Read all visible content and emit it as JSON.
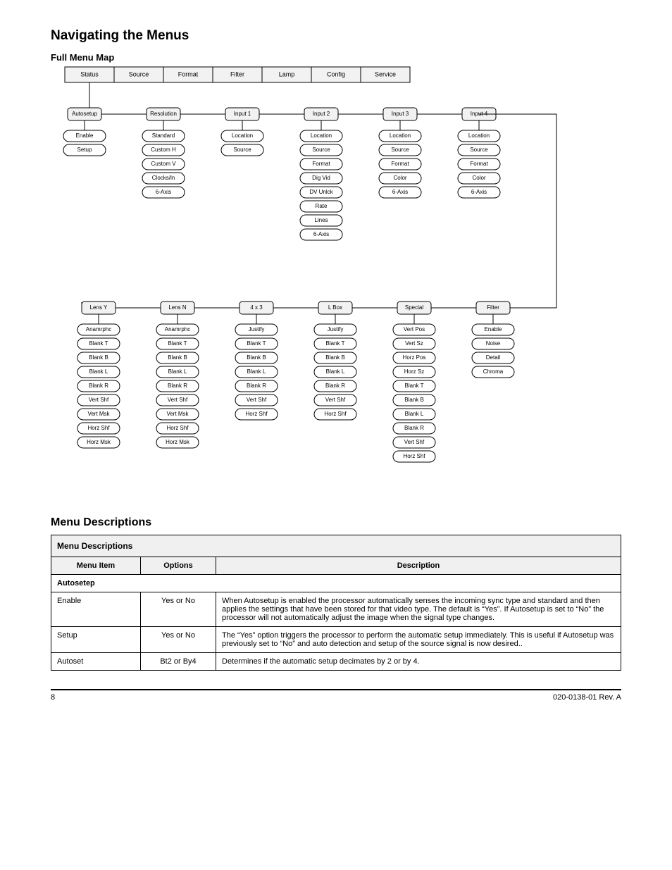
{
  "page": {
    "title": "Navigating the Menus",
    "diagram_label": "Full Menu Map",
    "menubar": [
      "Status",
      "Source",
      "Format",
      "Filter",
      "Lamp",
      "Config",
      "Service"
    ],
    "tree": {
      "row1": [
        {
          "head": "Autosetup",
          "items": [
            "Enable",
            "Setup"
          ]
        },
        {
          "head": "Resolution",
          "items": [
            "Standard",
            "Custom H",
            "Custom V",
            "Clocks/ln",
            "6-Axis"
          ]
        },
        {
          "head": "Input 1",
          "items": [
            "Location",
            "Source"
          ]
        },
        {
          "head": "Input 2",
          "items": [
            "Location",
            "Source",
            "Format",
            "Dig Vid",
            "DV Unlck",
            "Rate",
            "Lines",
            "6-Axis"
          ]
        },
        {
          "head": "Input 3",
          "items": [
            "Location",
            "Source",
            "Format",
            "Color",
            "6-Axis"
          ]
        },
        {
          "head": "Input 4",
          "items": [
            "Location",
            "Source",
            "Format",
            "Color",
            "6-Axis"
          ]
        }
      ],
      "row2": [
        {
          "head": "Lens Y",
          "items": [
            "Anamrphc",
            "Blank T",
            "Blank B",
            "Blank L",
            "Blank R",
            "Vert Shf",
            "Vert Msk",
            "Horz Shf",
            "Horz Msk"
          ]
        },
        {
          "head": "Lens N",
          "items": [
            "Anamrphc",
            "Blank T",
            "Blank B",
            "Blank L",
            "Blank R",
            "Vert Shf",
            "Vert Msk",
            "Horz Shf",
            "Horz Msk"
          ]
        },
        {
          "head": "4 x 3",
          "items": [
            "Justify",
            "Blank T",
            "Blank B",
            "Blank L",
            "Blank R",
            "Vert Shf",
            "Horz Shf"
          ]
        },
        {
          "head": "L Box",
          "items": [
            "Justify",
            "Blank T",
            "Blank B",
            "Blank L",
            "Blank R",
            "Vert Shf",
            "Horz Shf"
          ]
        },
        {
          "head": "Special",
          "items": [
            "Vert Pos",
            "Vert Sz",
            "Horz Pos",
            "Horz Sz",
            "Blank T",
            "Blank B",
            "Blank L",
            "Blank R",
            "Vert Shf",
            "Horz Shf"
          ]
        },
        {
          "head": "Filter",
          "items": [
            "Enable",
            "Noise",
            "Detail",
            "Chroma"
          ]
        }
      ]
    },
    "footer": {
      "left": "8",
      "right": "020-0138-01 Rev. A"
    }
  },
  "table": {
    "title": "Menu Descriptions",
    "columns": [
      "Menu Item",
      "Options",
      "Description"
    ],
    "section": "Autosetep",
    "rows": [
      {
        "item": "Enable",
        "opt": "Yes or No",
        "desc": "When Autosetup is enabled the processor automatically senses the incoming sync type and standard and then applies the settings that have been stored for that video type. The default is “Yes”. If Autosetup is set to “No” the processor will not automatically adjust the image when the signal type changes."
      },
      {
        "item": "Setup",
        "opt": "Yes or No",
        "desc": "The “Yes” option triggers the processor to perform the automatic setup immediately. This is useful if Autosetup was previously set to “No” and auto detection and setup of the source signal is now desired.."
      },
      {
        "item": "Autoset",
        "opt": "Bt2 or By4",
        "desc": "Determines if the automatic setup decimates by 2 or by 4."
      }
    ]
  }
}
